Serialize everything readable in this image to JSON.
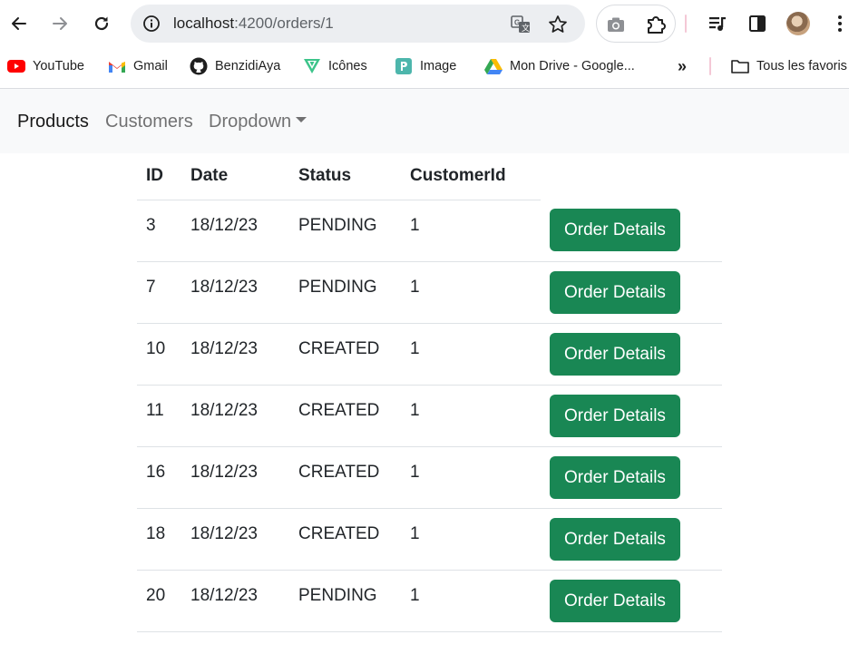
{
  "browser": {
    "url_host": "localhost",
    "url_path": ":4200/orders/1"
  },
  "bookmarks": {
    "items": [
      {
        "label": "YouTube",
        "icon": "youtube-icon"
      },
      {
        "label": "Gmail",
        "icon": "gmail-icon"
      },
      {
        "label": "BenzidiAya",
        "icon": "github-icon"
      },
      {
        "label": "Icônes",
        "icon": "icones-icon"
      },
      {
        "label": "Image",
        "icon": "image-icon"
      },
      {
        "label": "Mon Drive - Google...",
        "icon": "google-drive-icon"
      }
    ],
    "overflow": "»",
    "all_bookmarks": "Tous les favoris"
  },
  "navbar": {
    "links": [
      "Products",
      "Customers",
      "Dropdown"
    ]
  },
  "orders": {
    "columns": [
      "ID",
      "Date",
      "Status",
      "CustomerId"
    ],
    "rows": [
      {
        "id": "3",
        "date": "18/12/23",
        "status": "PENDING",
        "customer_id": "1"
      },
      {
        "id": "7",
        "date": "18/12/23",
        "status": "PENDING",
        "customer_id": "1"
      },
      {
        "id": "10",
        "date": "18/12/23",
        "status": "CREATED",
        "customer_id": "1"
      },
      {
        "id": "11",
        "date": "18/12/23",
        "status": "CREATED",
        "customer_id": "1"
      },
      {
        "id": "16",
        "date": "18/12/23",
        "status": "CREATED",
        "customer_id": "1"
      },
      {
        "id": "18",
        "date": "18/12/23",
        "status": "CREATED",
        "customer_id": "1"
      },
      {
        "id": "20",
        "date": "18/12/23",
        "status": "PENDING",
        "customer_id": "1"
      }
    ],
    "action_label": "Order Details"
  },
  "colors": {
    "success": "#198754",
    "navbar_bg": "#f8f9fa"
  }
}
